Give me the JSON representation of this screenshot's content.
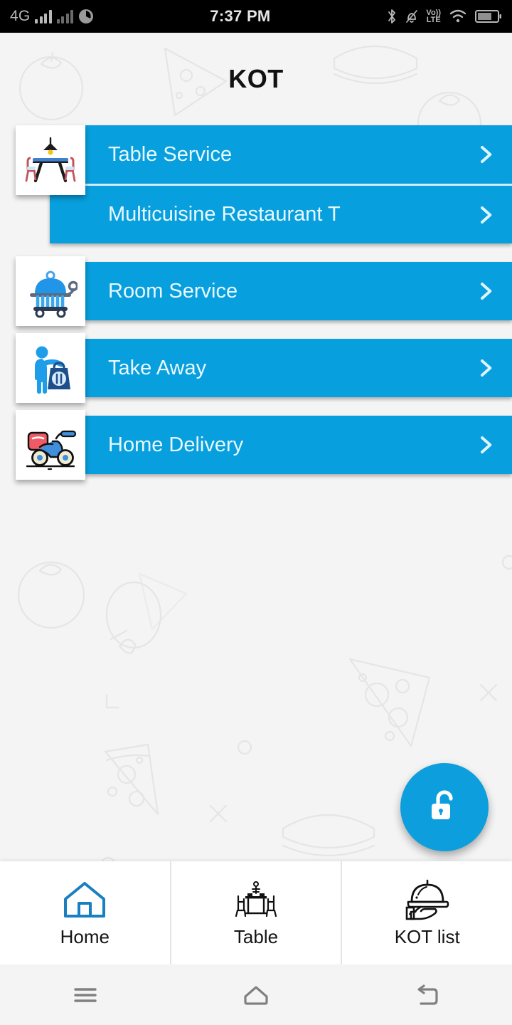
{
  "statusbar": {
    "network_label": "4G",
    "clock": "7:37 PM",
    "volte_top": "Vo))",
    "volte_bottom": "LTE",
    "icons": [
      "signal-bars-sim1",
      "signal-bars-sim2",
      "data-saver-icon",
      "bluetooth-icon",
      "mute-icon",
      "volte-icon",
      "wifi-icon",
      "battery-icon"
    ]
  },
  "header": {
    "title": "KOT"
  },
  "menu": {
    "items": [
      {
        "label": "Table Service",
        "icon": "dining-table-icon",
        "chevron": "chevron-right-icon",
        "sub": {
          "label": "Multicuisine Restaurant T",
          "chevron": "chevron-right-icon"
        }
      },
      {
        "label": "Room Service",
        "icon": "room-service-cart-icon",
        "chevron": "chevron-right-icon"
      },
      {
        "label": "Take Away",
        "icon": "takeaway-bag-icon",
        "chevron": "chevron-right-icon"
      },
      {
        "label": "Home Delivery",
        "icon": "delivery-scooter-icon",
        "chevron": "chevron-right-icon"
      }
    ]
  },
  "fab": {
    "icon": "unlock-icon",
    "label": ""
  },
  "bottomnav": {
    "items": [
      {
        "label": "Home",
        "icon": "home-icon",
        "active": true
      },
      {
        "label": "Table",
        "icon": "dining-table-icon",
        "active": false
      },
      {
        "label": "KOT list",
        "icon": "serving-cloche-icon",
        "active": false
      }
    ]
  },
  "androidnav": {
    "items": [
      {
        "icon": "menu-icon"
      },
      {
        "icon": "home-outline-icon"
      },
      {
        "icon": "back-icon"
      }
    ]
  },
  "colors": {
    "accent": "#079fdd",
    "fab": "#0d9edd",
    "row_text": "#e9f9ff",
    "page_bg": "#f4f4f4",
    "statusbar_bg": "#000000",
    "nav_active": "#1a7fc1"
  }
}
